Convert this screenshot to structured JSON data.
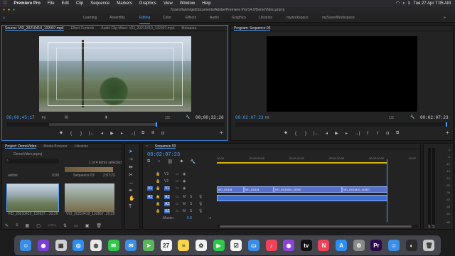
{
  "menubar": {
    "apple_icon": "apple-icon",
    "items": [
      "Premiere Pro",
      "File",
      "Edit",
      "Clip",
      "Sequence",
      "Markers",
      "Graphics",
      "View",
      "Window",
      "Help"
    ],
    "clock": "Tue 27 Apr  7:05 AM"
  },
  "titlebar": {
    "path": "/Users/lanmrge/Documents/Adobe/Premiere Pro/14.0/DemoVideo.prproj"
  },
  "workspaces": {
    "items": [
      "Learning",
      "Assembly",
      "Editing",
      "Color",
      "Effects",
      "Audio",
      "Graphics",
      "Libraries",
      "myworkspace",
      "mySavedWorkspace"
    ],
    "active": "Editing"
  },
  "source": {
    "tabs": [
      "Source: VID_20210410_132937.mp4",
      "Effect Controls",
      "Audio Clip Mixer: VID_20210410_132937.mp4",
      "Metadata"
    ],
    "tc_left": "00;00;45;17",
    "tc_right": "00;00;32;26",
    "fit": "Fit",
    "ratio": "1/2"
  },
  "program": {
    "tabs": [
      "Program: Sequence 03"
    ],
    "tc_left": "00:02:07:23",
    "tc_right": "00:02:07:23",
    "fit": "Fit",
    "ratio": "1/2"
  },
  "project": {
    "tabs": [
      "Project: DemoVideo",
      "Media Browser",
      "Libraries"
    ],
    "name": "DemoVideo.prproj",
    "selection": "1 of 4 items selected",
    "list": [
      {
        "name": "adobe",
        "value": "0;00"
      },
      {
        "name": "Sequence 03",
        "value": "2:07:23"
      }
    ],
    "thumbs": [
      {
        "name": "VID_20210410_132937...",
        "dur": "32;26"
      },
      {
        "name": "VID_20210410_132857...",
        "dur": "20;25"
      }
    ]
  },
  "timeline": {
    "tabs": [
      "Sequence 03"
    ],
    "timecode": "00:02:07:23",
    "ruler": [
      "00:00",
      "00:00:30:00",
      "00:01:00:00",
      "00:01:30:00",
      "00:02:00:00",
      "00:02"
    ],
    "tracks": [
      {
        "label": "V3"
      },
      {
        "label": "V2"
      },
      {
        "label": "V1"
      },
      {
        "label": "A1"
      },
      {
        "label": "A2"
      },
      {
        "label": "A3"
      }
    ],
    "master_label": "Master",
    "master_value": "0.0",
    "clips": [
      "VID_202104",
      "VID_202104",
      "VID_20210410_132937",
      "VID_20210410_132937"
    ]
  },
  "meters": {
    "labels": [
      "0",
      "-6",
      "-12",
      "-18",
      "-24",
      "-30",
      "-36",
      "-42",
      "-48",
      "-54",
      "dB"
    ],
    "solo": "S",
    "s2": "S"
  },
  "dock": {
    "apps": [
      {
        "icon": "finder-icon",
        "color": "#3a8ee6",
        "glyph": "☺"
      },
      {
        "icon": "siri-icon",
        "color": "#7a3fd0",
        "glyph": "◉"
      },
      {
        "icon": "launchpad-icon",
        "color": "#d0d0d0",
        "glyph": "▦"
      },
      {
        "icon": "safari-icon",
        "color": "#2c8ef0",
        "glyph": "◎"
      },
      {
        "icon": "chrome-icon",
        "color": "#e8e8e8",
        "glyph": "◍"
      },
      {
        "icon": "messages-icon",
        "color": "#2fc84a",
        "glyph": "✉"
      },
      {
        "icon": "mail-icon",
        "color": "#3a8ee6",
        "glyph": "✉"
      },
      {
        "icon": "maps-icon",
        "color": "#5ab65a",
        "glyph": "➤"
      },
      {
        "icon": "calendar-icon",
        "color": "#f4f4f4",
        "glyph": "27"
      },
      {
        "icon": "notes-icon",
        "color": "#f7d54a",
        "glyph": "≡"
      },
      {
        "icon": "photos-icon",
        "color": "#f2f2f2",
        "glyph": "✿"
      },
      {
        "icon": "facetime-icon",
        "color": "#2fc84a",
        "glyph": "▶"
      },
      {
        "icon": "reminders-icon",
        "color": "#f4f4f4",
        "glyph": "☑"
      },
      {
        "icon": "keynote-icon",
        "color": "#3a8ee6",
        "glyph": "▭"
      },
      {
        "icon": "music-icon",
        "color": "#f0435a",
        "glyph": "♪"
      },
      {
        "icon": "podcasts-icon",
        "color": "#8e44d6",
        "glyph": "◉"
      },
      {
        "icon": "tv-icon",
        "color": "#111111",
        "glyph": "tv"
      },
      {
        "icon": "news-icon",
        "color": "#f0435a",
        "glyph": "N"
      },
      {
        "icon": "appstore-icon",
        "color": "#2c8ef0",
        "glyph": "A"
      },
      {
        "icon": "settings-icon",
        "color": "#8a8a8a",
        "glyph": "⚙"
      },
      {
        "icon": "premiere-icon",
        "color": "#2a0a48",
        "glyph": "Pr"
      },
      {
        "icon": "finder2-icon",
        "color": "#3a8ee6",
        "glyph": "☺"
      },
      {
        "icon": "appleevents-icon",
        "color": "#2a2a2a",
        "glyph": "◐"
      },
      {
        "icon": "trash-icon",
        "color": "#c9c9c9",
        "glyph": "🗑"
      }
    ]
  }
}
